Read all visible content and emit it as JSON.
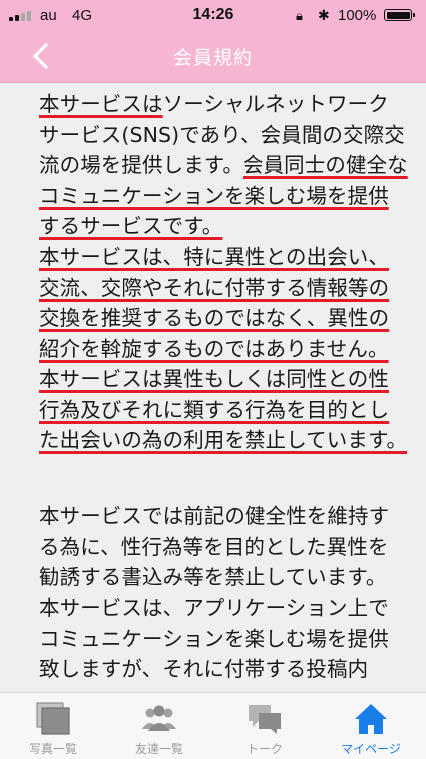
{
  "status_bar": {
    "carrier": "au",
    "network": "4G",
    "time": "14:26",
    "battery": "100%",
    "lock_icon": "orientation-lock-icon",
    "bluetooth_icon": "bluetooth-icon"
  },
  "nav": {
    "title": "会員規約",
    "back_icon": "chevron-left-icon"
  },
  "content": {
    "paragraphs": [
      {
        "plain_before": "",
        "highlight": "本サービスは",
        "plain_after": "ソーシャルネットワークサービス(SNS)であり、会員間の交際交流の場を提供します。"
      },
      {
        "plain_before": "",
        "highlight": "会員同士の健全なコミュニケーションを楽しむ場を提供するサービスです。",
        "plain_after": ""
      },
      {
        "plain_before": "",
        "highlight": "本サービスは、特に異性との出会い、交流、交際やそれに付帯する情報等の交換を推奨するものではなく、異性の紹介を斡旋するものではありません。",
        "plain_after": ""
      },
      {
        "plain_before": "",
        "highlight": "本サービスは異性もしくは同性との性行為及びそれに類する行為を目的とした出会いの為の利用を禁止しています。",
        "plain_after": ""
      },
      {
        "plain_before": "",
        "highlight": "",
        "plain_after": "本サービスでは前記の健全性を維持する為に、性行為等を目的とした異性を勧誘する書込み等を禁止しています。"
      },
      {
        "plain_before": "",
        "highlight": "",
        "plain_after": "本サービスは、アプリケーション上でコミュニケーションを楽しむ場を提供致しますが、それに付帯する投稿内"
      }
    ],
    "highlight_color": "#e31b2a"
  },
  "tabs": [
    {
      "label": "写真一覧",
      "icon": "photos-icon",
      "active": false
    },
    {
      "label": "友達一覧",
      "icon": "friends-icon",
      "active": false
    },
    {
      "label": "トーク",
      "icon": "talk-icon",
      "active": false
    },
    {
      "label": "マイページ",
      "icon": "home-icon",
      "active": true
    }
  ],
  "colors": {
    "header": "#f6b6d3",
    "active_tab": "#1a7ee8",
    "inactive_tab": "#9b9b9b"
  }
}
